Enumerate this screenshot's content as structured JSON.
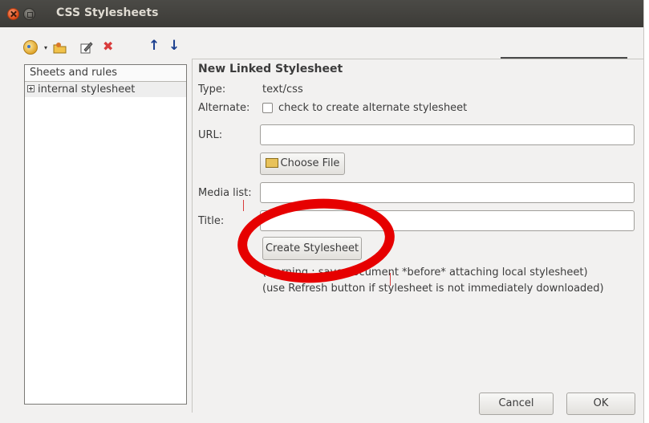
{
  "window": {
    "title": "CSS Stylesheets"
  },
  "toolbar": {
    "add_icon": "add-stylesheet-icon",
    "dropdown_icon": "dropdown-arrow-icon",
    "import_icon": "import-icon",
    "edit_icon": "edit-icon",
    "delete_icon": "delete-icon",
    "move_up_icon": "arrow-up-icon",
    "move_down_icon": "arrow-down-icon",
    "delete_glyph": "✖",
    "up_glyph": "↑",
    "down_glyph": "↓",
    "dropdown_glyph": "▾"
  },
  "sidebar": {
    "header": "Sheets and rules",
    "items": [
      {
        "label": "internal stylesheet",
        "expandable": true
      }
    ]
  },
  "form": {
    "title": "New Linked Stylesheet",
    "type_label": "Type:",
    "type_value": "text/css",
    "alternate_label": "Alternate:",
    "alternate_text": "check to create alternate stylesheet",
    "url_label": "URL:",
    "url_value": "",
    "choose_file_label": "Choose File",
    "media_label": "Media list:",
    "media_value": "",
    "title_label": "Title:",
    "title_value": "",
    "create_label": "Create Stylesheet",
    "note1": "(warning : save document *before* attaching local stylesheet)",
    "note2": "(use Refresh button if stylesheet is not immediately downloaded)"
  },
  "footer": {
    "cancel_label": "Cancel",
    "ok_label": "OK"
  },
  "colors": {
    "titlebar": "#3c3b37",
    "window_bg": "#f2f1f0",
    "annotation": "#e60000"
  }
}
